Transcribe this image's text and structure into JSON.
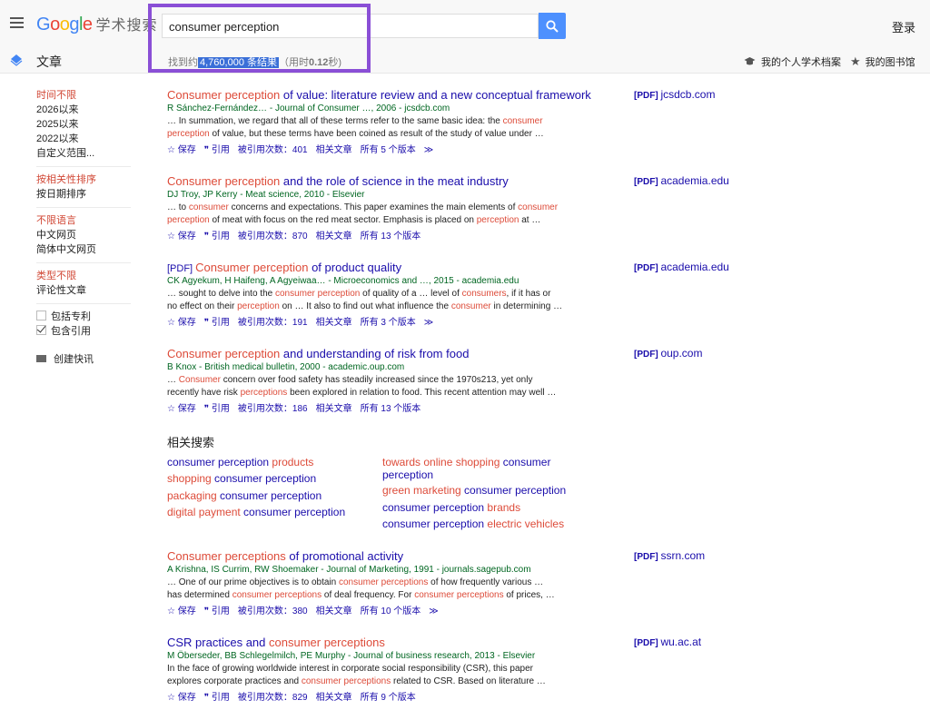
{
  "header": {
    "logo_google": "Google",
    "logo_cn": "学术搜索",
    "search_value": "consumer perception",
    "login": "登录",
    "section": "文章",
    "stats_prefix": "找到约",
    "stats_selected": "4,760,000 条结果",
    "stats_time_open": "（用时",
    "stats_time": "0.12",
    "stats_time_close": "秒)",
    "my_profile": "我的个人学术档案",
    "my_library": "我的图书馆"
  },
  "sidebar": {
    "time": [
      "时间不限",
      "2026以来",
      "2025以来",
      "2022以来",
      "自定义范围..."
    ],
    "sort": [
      "按相关性排序",
      "按日期排序"
    ],
    "lang": [
      "不限语言",
      "中文网页",
      "简体中文网页"
    ],
    "type": [
      "类型不限",
      "评论性文章"
    ],
    "include_patents": "包括专利",
    "include_citations": "包含引用",
    "alert": "创建快讯"
  },
  "results": [
    {
      "title_hl": "Consumer perception",
      "title_rest": " of value: literature review and a new conceptual framework",
      "authors": "R Sánchez-Fernández… - Journal of Consumer …, 2006 - jcsdcb.com",
      "snip1": "… In summation, we regard that all of these terms refer to the same basic idea: the consumer",
      "snip2": "perception of value, but these terms have been coined as result of the study of value under …",
      "cited": "被引用次数：401",
      "versions": "所有 5 个版本",
      "pdf_tag": "[PDF]",
      "pdf_host": "jcsdcb.com"
    },
    {
      "title_hl": "Consumer perception",
      "title_rest": " and the role of science in the meat industry",
      "authors": "DJ Troy, JP Kerry - Meat science, 2010 - Elsevier",
      "snip1": "… to consumer concerns and expectations. This paper examines the main elements of consumer",
      "snip2": "perception of meat with focus on the red meat sector. Emphasis is placed on perception at …",
      "cited": "被引用次数：870",
      "versions": "所有 13 个版本",
      "pdf_tag": "[PDF]",
      "pdf_host": "academia.edu"
    },
    {
      "prefix": "[PDF] ",
      "title_hl": "Consumer perception",
      "title_rest": " of product quality",
      "authors": "CK Agyekum, H Haifeng, A Agyeiwaa… - Microeconomics and …, 2015 - academia.edu",
      "snip1": "… sought to delve into the consumer perception of quality of a … level of consumers, if it has or",
      "snip2": "no effect on their perception on … It also to find out what influence the consumer in determining …",
      "cited": "被引用次数：191",
      "versions": "所有 3 个版本",
      "pdf_tag": "[PDF]",
      "pdf_host": "academia.edu"
    },
    {
      "title_hl": "Consumer perception",
      "title_rest": " and understanding of risk from food",
      "authors": "B Knox - British medical bulletin, 2000 - academic.oup.com",
      "snip1": "… Consumer concern over food safety has steadily increased since the 1970s213, yet only",
      "snip2": "recently have risk perceptions been explored in relation to food. This recent attention may well …",
      "cited": "被引用次数：186",
      "versions": "所有 13 个版本",
      "pdf_tag": "[PDF]",
      "pdf_host": "oup.com"
    },
    {
      "title_hl": "Consumer perceptions",
      "title_rest": " of promotional activity",
      "authors": "A Krishna, IS Currim, RW Shoemaker - Journal of Marketing, 1991 - journals.sagepub.com",
      "snip1": "… One of our prime objectives is to obtain consumer perceptions of how frequently various …",
      "snip2": "has determined consumer perceptions of deal frequency. For consumer perceptions of prices, …",
      "cited": "被引用次数：380",
      "versions": "所有 10 个版本",
      "pdf_tag": "[PDF]",
      "pdf_host": "ssrn.com"
    },
    {
      "title_pre": "CSR practices and ",
      "title_hl": "consumer perceptions",
      "title_rest": "",
      "authors": "M Öberseder, BB Schlegelmilch, PE Murphy - Journal of business research, 2013 - Elsevier",
      "snip1": "In the face of growing worldwide interest in corporate social responsibility (CSR), this paper",
      "snip2": "explores corporate practices and consumer perceptions related to CSR. Based on literature …",
      "cited": "被引用次数：829",
      "versions": "所有 9 个版本",
      "pdf_tag": "[PDF]",
      "pdf_host": "wu.ac.at"
    }
  ],
  "links": {
    "save": "保存",
    "cite": "引用",
    "related": "相关文章"
  },
  "related": {
    "heading": "相关搜索",
    "left": [
      [
        "consumer perception ",
        "products"
      ],
      [
        "shopping",
        " consumer perception"
      ],
      [
        "packaging",
        " consumer perception"
      ],
      [
        "digital payment",
        " consumer perception"
      ]
    ],
    "right": [
      [
        "towards online shopping",
        " consumer perception"
      ],
      [
        "green marketing",
        " consumer perception"
      ],
      [
        "consumer perception ",
        "brands"
      ],
      [
        "consumer perception ",
        "electric vehicles"
      ]
    ]
  }
}
